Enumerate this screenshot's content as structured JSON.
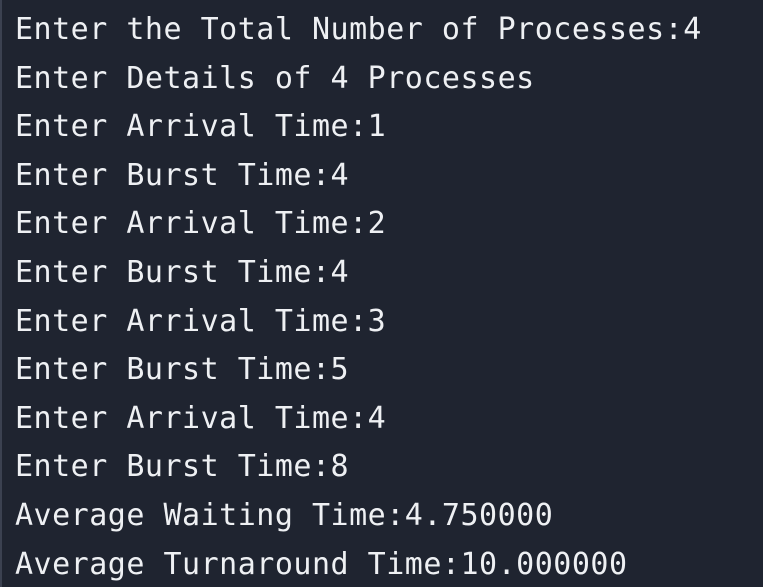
{
  "terminal": {
    "lines": [
      "Enter the Total Number of Processes:4",
      "Enter Details of 4 Processes",
      "Enter Arrival Time:1",
      "Enter Burst Time:4",
      "Enter Arrival Time:2",
      "Enter Burst Time:4",
      "Enter Arrival Time:3",
      "Enter Burst Time:5",
      "Enter Arrival Time:4",
      "Enter Burst Time:8",
      "Average Waiting Time:4.750000",
      "Average Turnaround Time:10.000000"
    ]
  },
  "colors": {
    "background": "#1f2430",
    "text": "#eef0f3"
  }
}
